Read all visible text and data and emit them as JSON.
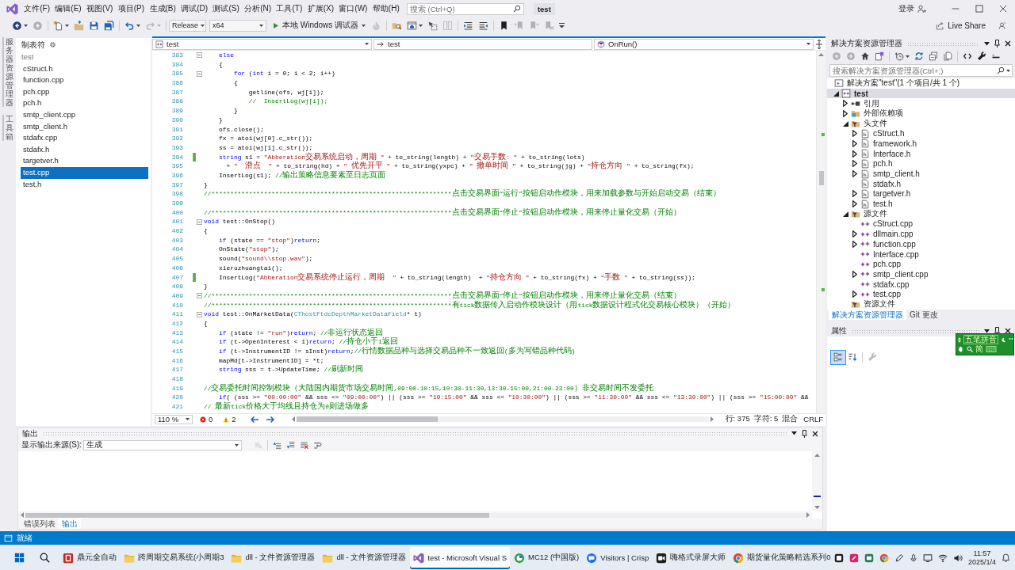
{
  "menu_bar": {
    "items": [
      "文件(F)",
      "编辑(E)",
      "视图(V)",
      "项目(P)",
      "生成(B)",
      "调试(D)",
      "测试(S)",
      "分析(N)",
      "工具(T)",
      "扩展(X)",
      "窗口(W)",
      "帮助(H)"
    ],
    "search": {
      "placeholder": "搜索 (Ctrl+Q)"
    },
    "solution_name": "test",
    "sign_in": "登录"
  },
  "toolbar": {
    "button_groups": [
      [
        {
          "kind": "back",
          "disabled": false,
          "dropdown": true
        },
        {
          "kind": "forward",
          "disabled": true,
          "dropdown": false
        }
      ],
      [
        {
          "kind": "new-item",
          "disabled": false,
          "dropdown": true
        },
        {
          "kind": "open",
          "disabled": false,
          "dropdown": false
        },
        {
          "kind": "save",
          "disabled": false,
          "dropdown": false
        },
        {
          "kind": "save-all",
          "disabled": false,
          "dropdown": false
        }
      ],
      [
        {
          "kind": "undo",
          "disabled": false,
          "dropdown": true
        },
        {
          "kind": "redo",
          "disabled": true,
          "dropdown": true
        }
      ]
    ],
    "configuration": "Release",
    "platform": "x64",
    "debugger": "本地 Windows 调试器",
    "tool_groups": [
      [
        {
          "kind": "hot-reload",
          "disabled": true,
          "dropdown": false
        }
      ],
      [
        {
          "kind": "find-folder",
          "disabled": false,
          "dropdown": false
        },
        {
          "kind": "browser",
          "disabled": false,
          "dropdown": true
        },
        {
          "kind": "pointer",
          "disabled": false,
          "dropdown": false
        },
        {
          "kind": "columns",
          "disabled": true,
          "dropdown": false
        }
      ],
      [
        {
          "kind": "comment",
          "disabled": false,
          "dropdown": false
        },
        {
          "kind": "uncomment",
          "disabled": false,
          "dropdown": false
        }
      ],
      [
        {
          "kind": "bookmark",
          "disabled": false,
          "dropdown": false
        },
        {
          "kind": "bookmark-prev",
          "disabled": true,
          "dropdown": false
        },
        {
          "kind": "bookmark-next",
          "disabled": true,
          "dropdown": false
        },
        {
          "kind": "bookmark-clear",
          "disabled": true,
          "dropdown": false
        }
      ]
    ],
    "live_share": "Live Share"
  },
  "side_tabs": [
    "服务器资源管理器",
    "工具箱"
  ],
  "tab_list": {
    "title": "制表符",
    "group": "test",
    "files": [
      {
        "name": "cStruct.h",
        "selected": false
      },
      {
        "name": "function.cpp",
        "selected": false
      },
      {
        "name": "pch.cpp",
        "selected": false
      },
      {
        "name": "pch.h",
        "selected": false
      },
      {
        "name": "smtp_client.cpp",
        "selected": false
      },
      {
        "name": "smtp_client.h",
        "selected": false
      },
      {
        "name": "stdafx.cpp",
        "selected": false
      },
      {
        "name": "stdafx.h",
        "selected": false
      },
      {
        "name": "targetver.h",
        "selected": false
      },
      {
        "name": "test.cpp",
        "selected": true
      },
      {
        "name": "test.h",
        "selected": false
      }
    ]
  },
  "editor": {
    "navigation": {
      "project": "test",
      "scope": "test",
      "member": "OnRun()"
    },
    "lines": [
      {
        "number": "383",
        "foldable": true,
        "changed": false,
        "segments": [
          {
            "text": "    else",
            "kind": "keyword"
          }
        ]
      },
      {
        "number": "384",
        "foldable": false,
        "changed": false,
        "segments": [
          {
            "text": "    {",
            "kind": "plain"
          }
        ]
      },
      {
        "number": "385",
        "foldable": true,
        "changed": false,
        "segments": [
          {
            "text": "        for",
            "kind": "keyword"
          },
          {
            "text": " (",
            "kind": "plain"
          },
          {
            "text": "int",
            "kind": "keyword"
          },
          {
            "text": " i = 0; i < 2; i++)",
            "kind": "plain"
          }
        ]
      },
      {
        "number": "386",
        "foldable": false,
        "changed": false,
        "segments": [
          {
            "text": "        {",
            "kind": "plain"
          }
        ]
      },
      {
        "number": "387",
        "foldable": false,
        "changed": false,
        "segments": [
          {
            "text": "            getline(ofs, wj[i]);",
            "kind": "plain"
          }
        ]
      },
      {
        "number": "388",
        "foldable": false,
        "changed": false,
        "segments": [
          {
            "text": "            //  InsertLog(wj[i]);",
            "kind": "comment"
          }
        ]
      },
      {
        "number": "389",
        "foldable": false,
        "changed": false,
        "segments": [
          {
            "text": "        }",
            "kind": "plain"
          }
        ]
      },
      {
        "number": "390",
        "foldable": false,
        "changed": false,
        "segments": [
          {
            "text": "    }",
            "kind": "plain"
          }
        ]
      },
      {
        "number": "391",
        "foldable": false,
        "changed": false,
        "segments": [
          {
            "text": "    ofs.close();",
            "kind": "plain"
          }
        ]
      },
      {
        "number": "392",
        "foldable": false,
        "changed": false,
        "segments": [
          {
            "text": "    fx = atoi(wj[0].c_str());",
            "kind": "plain"
          }
        ]
      },
      {
        "number": "393",
        "foldable": false,
        "changed": false,
        "segments": [
          {
            "text": "    ss = atoi(wj[1].c_str());",
            "kind": "plain"
          }
        ]
      },
      {
        "number": "394",
        "foldable": false,
        "changed": true,
        "segments": [
          {
            "text": "    string",
            "kind": "keyword"
          },
          {
            "text": " s1 = ",
            "kind": "plain"
          },
          {
            "text": "\"Abberation交易系统启动，周期 \"",
            "kind": "string"
          },
          {
            "text": " + to_string(length) + ",
            "kind": "plain"
          },
          {
            "text": "\"交易手数: \"",
            "kind": "string"
          },
          {
            "text": " + to_string(lots)",
            "kind": "plain"
          }
        ]
      },
      {
        "number": "395",
        "foldable": false,
        "changed": false,
        "segments": [
          {
            "text": "      + ",
            "kind": "plain"
          },
          {
            "text": "\"  滑点  \"",
            "kind": "string"
          },
          {
            "text": " + to_string(hd) + ",
            "kind": "plain"
          },
          {
            "text": "\" 优先开平 \"",
            "kind": "string"
          },
          {
            "text": " + to_string(yxpc) + ",
            "kind": "plain"
          },
          {
            "text": "\" 撤单时间 \"",
            "kind": "string"
          },
          {
            "text": " + to_string(jg) + ",
            "kind": "plain"
          },
          {
            "text": "\"持仓方向 \"",
            "kind": "string"
          },
          {
            "text": " + to_string(fx);",
            "kind": "plain"
          }
        ]
      },
      {
        "number": "396",
        "foldable": false,
        "changed": false,
        "segments": [
          {
            "text": "    InsertLog(s1); ",
            "kind": "plain"
          },
          {
            "text": "//输出策略信息要素至日志页面",
            "kind": "comment"
          }
        ]
      },
      {
        "number": "397",
        "foldable": false,
        "changed": false,
        "segments": [
          {
            "text": "}",
            "kind": "plain"
          }
        ]
      },
      {
        "number": "398",
        "foldable": false,
        "changed": false,
        "segments": [
          {
            "text": "//****************************************************************点击交易界面“运行”按钮启动作模块，用来加载参数与开始启动交易（结束）",
            "kind": "comment"
          }
        ]
      },
      {
        "number": "399",
        "foldable": false,
        "changed": false
      },
      {
        "number": "400",
        "foldable": false,
        "changed": false,
        "segments": [
          {
            "text": "//****************************************************************点击交易界面“停止”按钮启动作模块，用来停止量化交易（开始）",
            "kind": "comment"
          }
        ]
      },
      {
        "number": "401",
        "foldable": true,
        "changed": false,
        "segments": [
          {
            "text": "void",
            "kind": "keyword"
          },
          {
            "text": " test::OnStop()",
            "kind": "plain"
          }
        ]
      },
      {
        "number": "402",
        "foldable": false,
        "changed": false,
        "segments": [
          {
            "text": "{",
            "kind": "plain"
          }
        ]
      },
      {
        "number": "403",
        "foldable": false,
        "changed": false,
        "segments": [
          {
            "text": "    if",
            "kind": "keyword"
          },
          {
            "text": " (state == ",
            "kind": "plain"
          },
          {
            "text": "\"stop\"",
            "kind": "string"
          },
          {
            "text": ")",
            "kind": "plain"
          },
          {
            "text": "return",
            "kind": "keyword"
          },
          {
            "text": ";",
            "kind": "plain"
          }
        ]
      },
      {
        "number": "404",
        "foldable": false,
        "changed": false,
        "segments": [
          {
            "text": "    OnState(",
            "kind": "plain"
          },
          {
            "text": "\"stop\"",
            "kind": "string"
          },
          {
            "text": ");",
            "kind": "plain"
          }
        ]
      },
      {
        "number": "405",
        "foldable": false,
        "changed": false,
        "segments": [
          {
            "text": "    sound(",
            "kind": "plain"
          },
          {
            "text": "\"sound\\\\stop.wav\"",
            "kind": "string"
          },
          {
            "text": ");",
            "kind": "plain"
          }
        ]
      },
      {
        "number": "406",
        "foldable": false,
        "changed": false,
        "segments": [
          {
            "text": "    xieruzhuangtai();",
            "kind": "plain"
          }
        ]
      },
      {
        "number": "407",
        "foldable": false,
        "changed": true,
        "segments": [
          {
            "text": "    InsertLog(",
            "kind": "plain"
          },
          {
            "text": "\"Abberation交易系统停止运行，周期  \"",
            "kind": "string"
          },
          {
            "text": " + to_string(length)  + ",
            "kind": "plain"
          },
          {
            "text": "\"持仓方向 \"",
            "kind": "string"
          },
          {
            "text": " + to_string(fx) + ",
            "kind": "plain"
          },
          {
            "text": "\"手数 \"",
            "kind": "string"
          },
          {
            "text": " + to_string(ss));",
            "kind": "plain"
          }
        ]
      },
      {
        "number": "408",
        "foldable": false,
        "changed": false,
        "segments": [
          {
            "text": "}",
            "kind": "plain"
          }
        ]
      },
      {
        "number": "409",
        "foldable": true,
        "changed": false,
        "segments": [
          {
            "text": "//****************************************************************点击交易界面“停止”按钮启动作模块，用来停止量化交易（结束）",
            "kind": "comment"
          }
        ]
      },
      {
        "number": "410",
        "foldable": false,
        "changed": false,
        "segments": [
          {
            "text": "//****************************************************************有tick数据传入启动作模块设计（用tick数据设计程式化交易核心模块）（开始）",
            "kind": "comment"
          }
        ]
      },
      {
        "number": "411",
        "foldable": true,
        "changed": false,
        "segments": [
          {
            "text": "void",
            "kind": "keyword"
          },
          {
            "text": " test::OnMarketData(",
            "kind": "plain"
          },
          {
            "text": "CThostFtdcDepthMarketDataField",
            "kind": "type"
          },
          {
            "text": "* t)",
            "kind": "plain"
          }
        ]
      },
      {
        "number": "412",
        "foldable": false,
        "changed": false,
        "segments": [
          {
            "text": "{",
            "kind": "plain"
          }
        ]
      },
      {
        "number": "413",
        "foldable": false,
        "changed": false,
        "segments": [
          {
            "text": "    if",
            "kind": "keyword"
          },
          {
            "text": " (state != ",
            "kind": "plain"
          },
          {
            "text": "\"run\"",
            "kind": "string"
          },
          {
            "text": ")",
            "kind": "plain"
          },
          {
            "text": "return",
            "kind": "keyword"
          },
          {
            "text": "; ",
            "kind": "plain"
          },
          {
            "text": "//非运行状态返回",
            "kind": "comment"
          }
        ]
      },
      {
        "number": "414",
        "foldable": false,
        "changed": false,
        "segments": [
          {
            "text": "    if",
            "kind": "keyword"
          },
          {
            "text": " (t->OpenInterest < 1)",
            "kind": "plain"
          },
          {
            "text": "return",
            "kind": "keyword"
          },
          {
            "text": "; ",
            "kind": "plain"
          },
          {
            "text": "//持仓小于1返回",
            "kind": "comment"
          }
        ]
      },
      {
        "number": "415",
        "foldable": false,
        "changed": false,
        "segments": [
          {
            "text": "    if",
            "kind": "keyword"
          },
          {
            "text": " (t->InstrumentID != sInst)",
            "kind": "plain"
          },
          {
            "text": "return",
            "kind": "keyword"
          },
          {
            "text": ";",
            "kind": "plain"
          },
          {
            "text": "//行情数据品种与选择交易品种不一致返回(多为写错品种代码)",
            "kind": "comment"
          }
        ]
      },
      {
        "number": "416",
        "foldable": false,
        "changed": false,
        "segments": [
          {
            "text": "    mapMd[t->InstrumentID] = *t;",
            "kind": "plain"
          }
        ]
      },
      {
        "number": "417",
        "foldable": false,
        "changed": false,
        "segments": [
          {
            "text": "    string",
            "kind": "keyword"
          },
          {
            "text": " sss = t->UpdateTime; ",
            "kind": "plain"
          },
          {
            "text": "//刷新时间",
            "kind": "comment"
          }
        ]
      },
      {
        "number": "418",
        "foldable": false,
        "changed": false
      },
      {
        "number": "419",
        "foldable": false,
        "changed": false,
        "segments": [
          {
            "text": "//交易委托时间控制模块（大陆国内期货市场交易时间,09:00-10:15,10:30-11:30,13:30-15:00,21:00-23:00）非交易时间不发委托",
            "kind": "comment"
          }
        ]
      },
      {
        "number": "420",
        "foldable": false,
        "changed": false,
        "segments": [
          {
            "text": "    if",
            "kind": "keyword"
          },
          {
            "text": "( (sss >= ",
            "kind": "plain"
          },
          {
            "text": "\"00:00:00\"",
            "kind": "string"
          },
          {
            "text": " && sss <= ",
            "kind": "plain"
          },
          {
            "text": "\"09:00:00\"",
            "kind": "string"
          },
          {
            "text": ") || (sss >= ",
            "kind": "plain"
          },
          {
            "text": "\"10:15:00\"",
            "kind": "string"
          },
          {
            "text": " && sss <= ",
            "kind": "plain"
          },
          {
            "text": "\"10:30:00\"",
            "kind": "string"
          },
          {
            "text": ") || (sss >= ",
            "kind": "plain"
          },
          {
            "text": "\"11:30:00\"",
            "kind": "string"
          },
          {
            "text": " && sss <= ",
            "kind": "plain"
          },
          {
            "text": "\"13:30:00\"",
            "kind": "string"
          },
          {
            "text": ") || (sss >= ",
            "kind": "plain"
          },
          {
            "text": "\"15:00:00\"",
            "kind": "string"
          },
          {
            "text": " &&",
            "kind": "plain"
          }
        ]
      },
      {
        "number": "421",
        "foldable": false,
        "changed": false,
        "segments": [
          {
            "text": "// 最新tick价格大于均线且持仓为0则进场做多",
            "kind": "comment"
          }
        ]
      }
    ],
    "zoom": "110 %",
    "errors": "0",
    "warnings": "2",
    "line": "行: 375",
    "character": "字符: 5",
    "indentation": "混合",
    "line_ending": "CRLF"
  },
  "output": {
    "title": "输出",
    "source_label": "显示输出来源(S):",
    "source": "生成",
    "toolbar_groups": [
      [
        {
          "kind": "find-message",
          "disabled": true
        }
      ],
      [
        {
          "kind": "prev-message",
          "disabled": false
        },
        {
          "kind": "next-message",
          "disabled": false
        },
        {
          "kind": "clear-all",
          "disabled": false
        },
        {
          "kind": "word-wrap",
          "disabled": false
        }
      ]
    ],
    "tabs": [
      {
        "label": "错误列表",
        "selected": false
      },
      {
        "label": "输出",
        "selected": true
      }
    ]
  },
  "solution_explorer": {
    "title": "解决方案资源管理器",
    "toolbar_groups": [
      [
        {
          "kind": "back",
          "disabled": true,
          "dropdown": false
        },
        {
          "kind": "forward",
          "disabled": true,
          "dropdown": false
        },
        {
          "kind": "home",
          "disabled": false,
          "dropdown": false
        },
        {
          "kind": "switch-views",
          "disabled": false,
          "dropdown": false
        }
      ],
      [
        {
          "kind": "history",
          "disabled": false,
          "dropdown": true
        },
        {
          "kind": "sync",
          "disabled": false,
          "dropdown": false
        },
        {
          "kind": "collapse",
          "disabled": false,
          "dropdown": false
        },
        {
          "kind": "show-all",
          "disabled": false,
          "dropdown": false
        }
      ],
      [
        {
          "kind": "code",
          "disabled": false,
          "dropdown": false
        },
        {
          "kind": "properties",
          "disabled": false,
          "dropdown": false
        },
        {
          "kind": "preview",
          "disabled": false,
          "dropdown": false
        }
      ]
    ],
    "search": {
      "placeholder": "搜索解决方案资源管理器(Ctrl+;)"
    },
    "solution": "解决方案\"test\"(1 个项目/共 1 个)",
    "tree": [
      {
        "label": "test",
        "kind": "project",
        "expanded": true,
        "selected": true,
        "children": [
          {
            "label": "引用",
            "kind": "references",
            "expanded": false,
            "selected": false
          },
          {
            "label": "外部依赖项",
            "kind": "external",
            "expanded": false,
            "selected": false
          },
          {
            "label": "头文件",
            "kind": "filter",
            "expanded": true,
            "selected": false,
            "children": [
              {
                "label": "cStruct.h",
                "kind": "header",
                "expanded": false,
                "selected": false
              },
              {
                "label": "framework.h",
                "kind": "header",
                "expanded": false,
                "selected": false
              },
              {
                "label": "Interface.h",
                "kind": "header",
                "expanded": false,
                "selected": false
              },
              {
                "label": "pch.h",
                "kind": "header",
                "expanded": false,
                "selected": false
              },
              {
                "label": "smtp_client.h",
                "kind": "header",
                "expanded": false,
                "selected": false
              },
              {
                "label": "stdafx.h",
                "kind": "header",
                "selected": false
              },
              {
                "label": "targetver.h",
                "kind": "header",
                "expanded": false,
                "selected": false
              },
              {
                "label": "test.h",
                "kind": "header",
                "expanded": false,
                "selected": false
              }
            ]
          },
          {
            "label": "源文件",
            "kind": "filter",
            "expanded": true,
            "selected": false,
            "children": [
              {
                "label": "cStruct.cpp",
                "kind": "source",
                "selected": false
              },
              {
                "label": "dllmain.cpp",
                "kind": "source",
                "expanded": false,
                "selected": false
              },
              {
                "label": "function.cpp",
                "kind": "source",
                "expanded": false,
                "selected": false
              },
              {
                "label": "Interface.cpp",
                "kind": "source",
                "selected": false
              },
              {
                "label": "pch.cpp",
                "kind": "source",
                "selected": false
              },
              {
                "label": "smtp_client.cpp",
                "kind": "source",
                "expanded": false,
                "selected": false
              },
              {
                "label": "stdafx.cpp",
                "kind": "source",
                "selected": false
              },
              {
                "label": "test.cpp",
                "kind": "source",
                "expanded": false,
                "selected": false
              }
            ]
          },
          {
            "label": "资源文件",
            "kind": "filter",
            "selected": false
          }
        ]
      }
    ],
    "tabs": [
      {
        "label": "解决方案资源管理器",
        "selected": true
      },
      {
        "label": "Git 更改",
        "selected": false
      }
    ]
  },
  "properties": {
    "title": "属性",
    "toolbar_groups": [
      [
        {
          "kind": "categorized",
          "selected": true,
          "disabled": false
        },
        {
          "kind": "alphabetical",
          "selected": false,
          "disabled": false
        }
      ],
      [
        {
          "kind": "property-pages",
          "selected": false,
          "disabled": true
        }
      ]
    ]
  },
  "ime": {
    "input_method": "五笔拼音",
    "script": "简"
  },
  "status_bar": {
    "text": "就绪"
  },
  "taskbar": {
    "apps": [
      {
        "label": "鼎元全自动",
        "kind": "tile",
        "active": false
      },
      {
        "label": "跨周期交易系统(小周期3",
        "kind": "folder",
        "active": false
      },
      {
        "label": "dll - 文件资源管理器",
        "kind": "folder",
        "active": false
      },
      {
        "label": "dll - 文件资源管理器",
        "kind": "folder",
        "active": false
      },
      {
        "label": "test - Microsoft Visual S",
        "kind": "ide",
        "active": true
      },
      {
        "label": "MC12 (中国版)",
        "kind": "circle",
        "active": false
      },
      {
        "label": "Visitors | Crisp",
        "kind": "chat",
        "active": false
      },
      {
        "label": "嗨格式录屏大师",
        "kind": "camera",
        "active": false
      },
      {
        "label": "期货量化策略精选系列0",
        "kind": "browser",
        "active": false
      }
    ],
    "time": "11:57",
    "date": "2025/1/4"
  }
}
